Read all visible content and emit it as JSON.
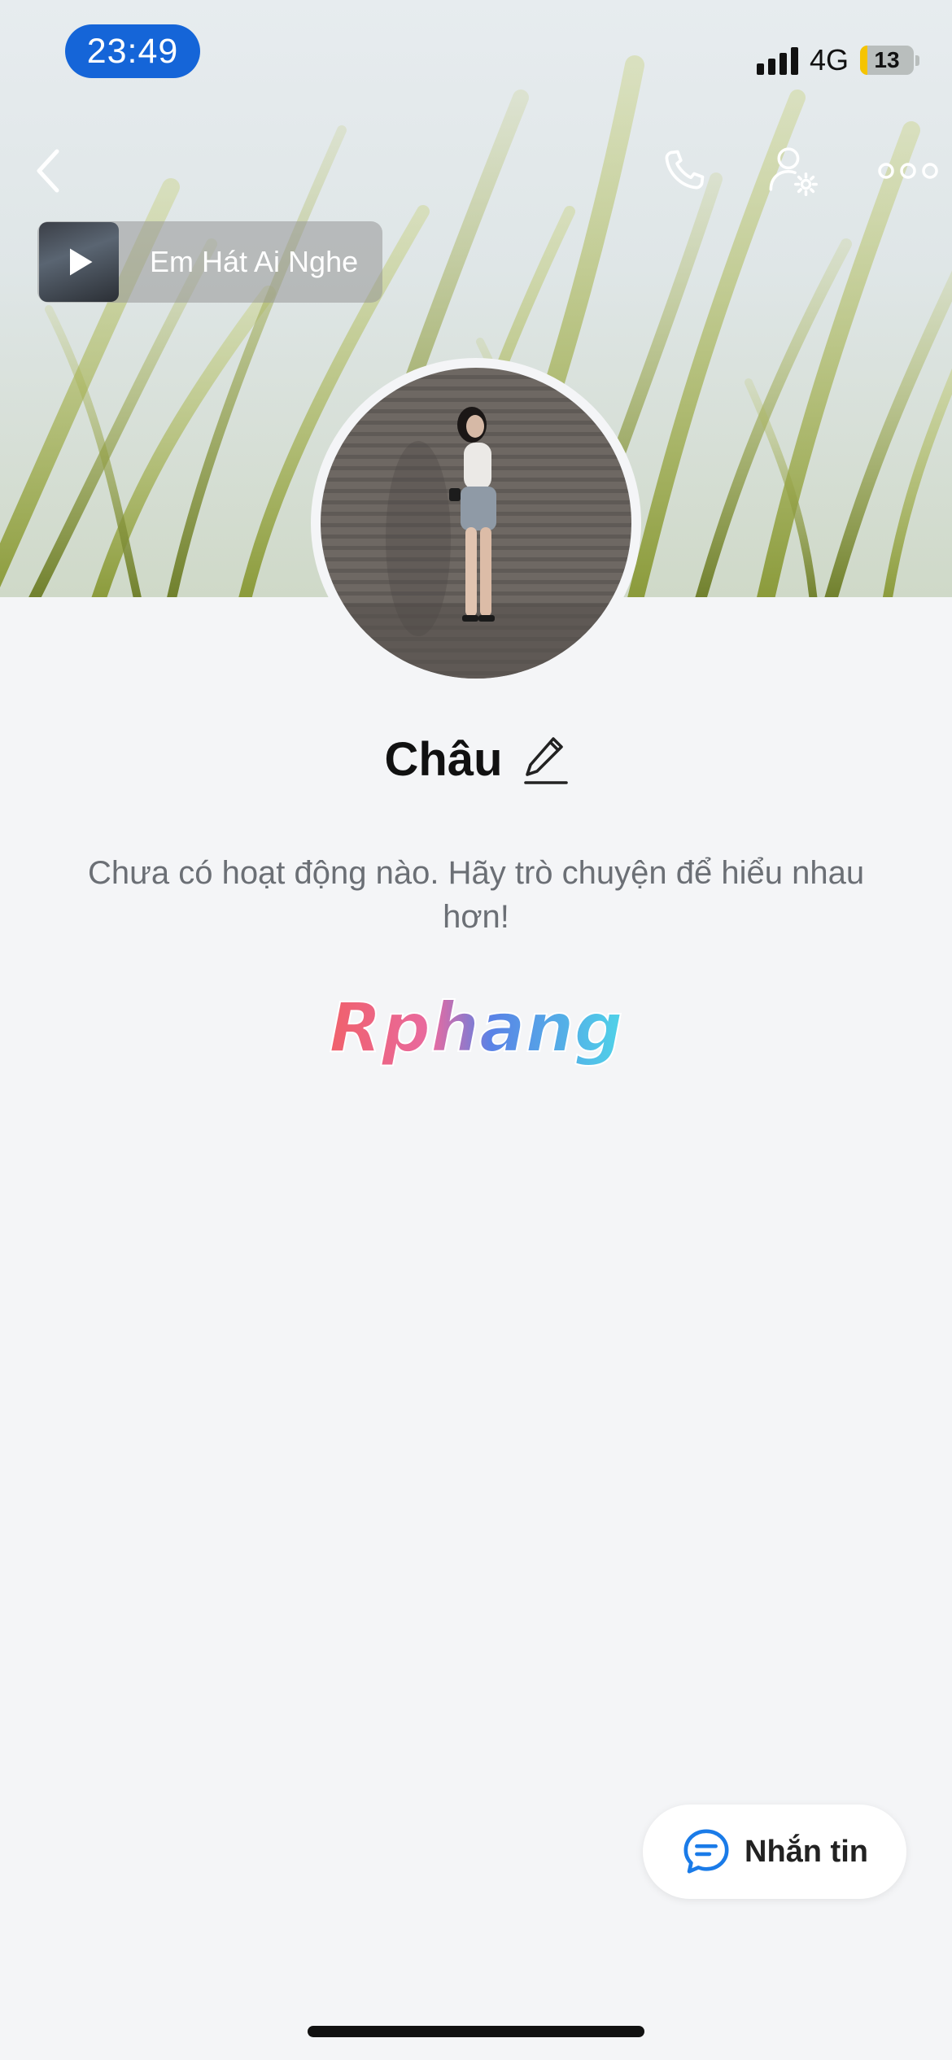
{
  "status_bar": {
    "time": "23:49",
    "network": "4G",
    "battery": "13",
    "battery_level": 0.13
  },
  "header": {
    "back_icon": "chevron-left-icon",
    "call_icon": "phone-icon",
    "settings_icon": "person-gear-icon",
    "more_icon": "more-dots-icon"
  },
  "music": {
    "title": "Em Hát Ai Nghe",
    "play_icon": "play-icon"
  },
  "profile": {
    "name": "Châu",
    "edit_icon": "pencil-icon",
    "empty_message": "Chưa có hoạt động nào. Hãy trò chuyện để hiểu nhau hơn!",
    "watermark": "Rphang"
  },
  "actions": {
    "message_label": "Nhắn tin",
    "message_icon": "chat-bubble-icon"
  },
  "colors": {
    "accent": "#1565d8",
    "message_icon": "#1a7be8",
    "background": "#f4f5f7"
  }
}
